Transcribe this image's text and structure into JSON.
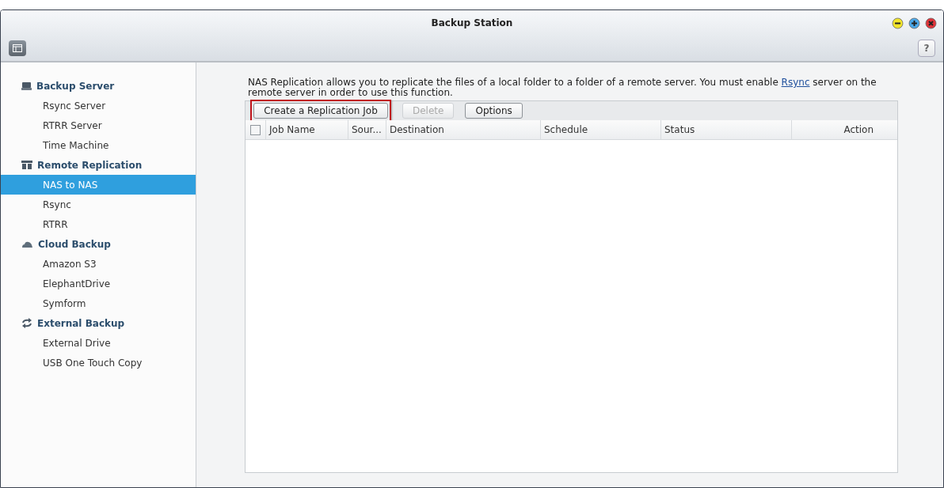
{
  "window": {
    "title": "Backup Station"
  },
  "sidebar": {
    "groups": [
      {
        "label": "Backup Server",
        "kind": "server",
        "items": [
          {
            "label": "Rsync Server",
            "selected": false
          },
          {
            "label": "RTRR Server",
            "selected": false
          },
          {
            "label": "Time Machine",
            "selected": false
          }
        ]
      },
      {
        "label": "Remote Replication",
        "kind": "replication",
        "items": [
          {
            "label": "NAS to NAS",
            "selected": true
          },
          {
            "label": "Rsync",
            "selected": false
          },
          {
            "label": "RTRR",
            "selected": false
          }
        ]
      },
      {
        "label": "Cloud Backup",
        "kind": "cloud",
        "items": [
          {
            "label": "Amazon S3",
            "selected": false
          },
          {
            "label": "ElephantDrive",
            "selected": false
          },
          {
            "label": "Symform",
            "selected": false
          }
        ]
      },
      {
        "label": "External Backup",
        "kind": "external",
        "items": [
          {
            "label": "External Drive",
            "selected": false
          },
          {
            "label": "USB One Touch Copy",
            "selected": false
          }
        ]
      }
    ]
  },
  "description": {
    "before": "NAS Replication allows you to replicate the files of a local folder to a folder of a remote server. You must enable ",
    "link": "Rsync",
    "after": " server on the remote server in order to use this function."
  },
  "toolbar": [
    {
      "label": "Create a Replication Job",
      "disabled": false,
      "highlighted": true
    },
    {
      "label": "Delete",
      "disabled": true,
      "highlighted": false
    },
    {
      "label": "Options",
      "disabled": false,
      "highlighted": false
    }
  ],
  "table": {
    "select_all": {
      "checked": false
    },
    "columns": [
      {
        "label": "Job Name"
      },
      {
        "label": "Sour..."
      },
      {
        "label": "Destination"
      },
      {
        "label": "Schedule"
      },
      {
        "label": "Status"
      },
      {
        "label": "Action"
      }
    ]
  },
  "help": {
    "label": "?"
  }
}
